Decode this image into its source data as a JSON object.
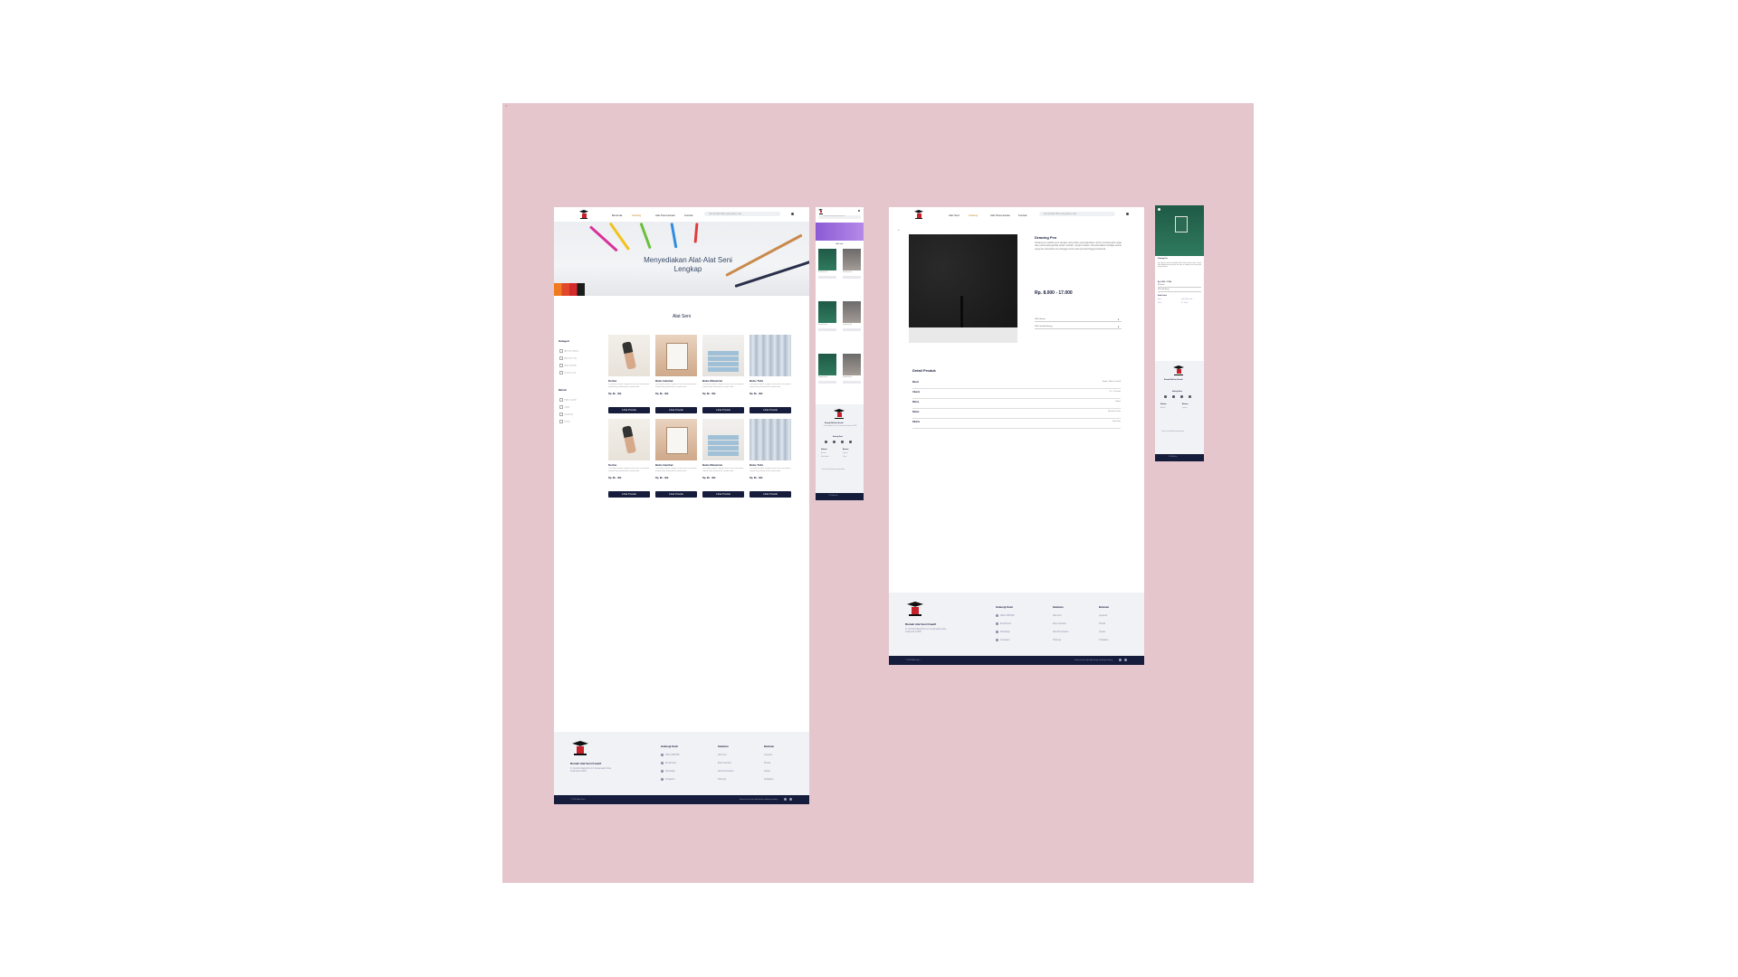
{
  "nav": {
    "links": [
      "Beranda",
      "Katalog",
      "Alat Pemesanan",
      "Kontak"
    ],
    "search_placeholder": "Cari produk disini yang kamu mau",
    "detail_links": [
      "Alat Seni",
      "Katalog",
      "Alat Pemesanan",
      "Kontak"
    ]
  },
  "hero": {
    "title": "Menyediakan Alat-Alat Seni Lengkap"
  },
  "catalog": {
    "section_title": "Alat Seni",
    "filters": [
      {
        "title": "Kategori",
        "items": [
          "Alat Seni Warna",
          "Alat Seni Tulis",
          "Buku Gambar",
          "Kanvas Lukis"
        ]
      },
      {
        "title": "Merek",
        "items": [
          "Faber Castell",
          "Joyko",
          "Snowman",
          "Kenko"
        ]
      }
    ],
    "products": [
      {
        "name": "Kertas",
        "desc": "Deskripsi produk singkat untuk alat seni pilihan terbaik bagi kebutuhan kreatif anda",
        "price": "Rp. 8k - 30k",
        "button": "Lihat Produk",
        "img": "hand"
      },
      {
        "name": "Buku Gambar",
        "desc": "Deskripsi produk singkat untuk alat seni pilihan terbaik bagi kebutuhan kreatif anda",
        "price": "Rp. 8k - 30k",
        "button": "Lihat Produk",
        "img": "easel"
      },
      {
        "name": "Buku Mewarnai",
        "desc": "Deskripsi produk singkat untuk alat seni pilihan terbaik bagi kebutuhan kreatif anda",
        "price": "Rp. 8k - 30k",
        "button": "Lihat Produk",
        "img": "books"
      },
      {
        "name": "Buku Tulis",
        "desc": "Deskripsi produk singkat untuk alat seni pilihan terbaik bagi kebutuhan kreatif anda",
        "price": "Rp. 8k - 30k",
        "button": "Lihat Produk",
        "img": "curtain"
      },
      {
        "name": "Kertas",
        "desc": "Deskripsi produk singkat untuk alat seni pilihan terbaik bagi kebutuhan kreatif anda",
        "price": "Rp. 8k - 30k",
        "button": "Lihat Produk",
        "img": "hand"
      },
      {
        "name": "Buku Gambar",
        "desc": "Deskripsi produk singkat untuk alat seni pilihan terbaik bagi kebutuhan kreatif anda",
        "price": "Rp. 8k - 30k",
        "button": "Lihat Produk",
        "img": "easel"
      },
      {
        "name": "Buku Mewarnai",
        "desc": "Deskripsi produk singkat untuk alat seni pilihan terbaik bagi kebutuhan kreatif anda",
        "price": "Rp. 8k - 30k",
        "button": "Lihat Produk",
        "img": "books"
      },
      {
        "name": "Buku Tulis",
        "desc": "Deskripsi produk singkat untuk alat seni pilihan terbaik bagi kebutuhan kreatif anda",
        "price": "Rp. 8k - 30k",
        "button": "Lihat Produk",
        "img": "curtain"
      }
    ]
  },
  "footer": {
    "brand": "Rumah Alat Seni Kreatif",
    "address": "Jl. Contoh Alamat No.12, Kecamatan Kota, Indonesia 12345",
    "columns": [
      {
        "title": "Hubungi Kami",
        "items": [
          "0812-3456789",
          "Email Kami",
          "Whatsapp",
          "Instagram"
        ]
      },
      {
        "title": "Halaman",
        "items": [
          "Alat Seni",
          "Buku Gambar",
          "Alat Pemesanan",
          "Hubungi"
        ]
      },
      {
        "title": "Bantuan",
        "items": [
          "Layanan",
          "Privasi",
          "Syarat",
          "Kebijakan"
        ]
      }
    ],
    "copyright": "© 2023 Alat Seni",
    "rights": "Semua hak cipta dilindungi undang-undang"
  },
  "detail": {
    "title": "Drawing Pen",
    "desc": "Drawing pen adalah pena dengan ujung halus yang digunakan untuk membuat garis tegas dan presisi pada gambar teknik, ilustrasi, maupun sketsa. Tersedia dalam berbagai ukuran ujung dan tinta tahan air sehingga cocok untuk pemula hingga profesional.",
    "price": "Rp. 8.000 - 17.000",
    "select_size": "Pilih Ukuran",
    "select_qty": "Pilih Jumlah Barang",
    "section_title": "Detail Produk",
    "specs": [
      {
        "k": "Merek",
        "v": "Joyko / Faber Castell"
      },
      {
        "k": "Ukuran",
        "v": "0.1 - 0.8 mm"
      },
      {
        "k": "Warna",
        "v": "Hitam"
      },
      {
        "k": "Bahan",
        "v": "Plastik & Tinta"
      },
      {
        "k": "Dikirim",
        "v": "Dari Kota"
      }
    ]
  },
  "mobile": {
    "section_title": "Alat Seni",
    "tile_caption": "Produk Rp. 8k"
  },
  "colors": {
    "canvas": "#e6c6cd",
    "navy": "#161c3b",
    "accent": "#d08a2a",
    "logo_red": "#c8202b"
  }
}
